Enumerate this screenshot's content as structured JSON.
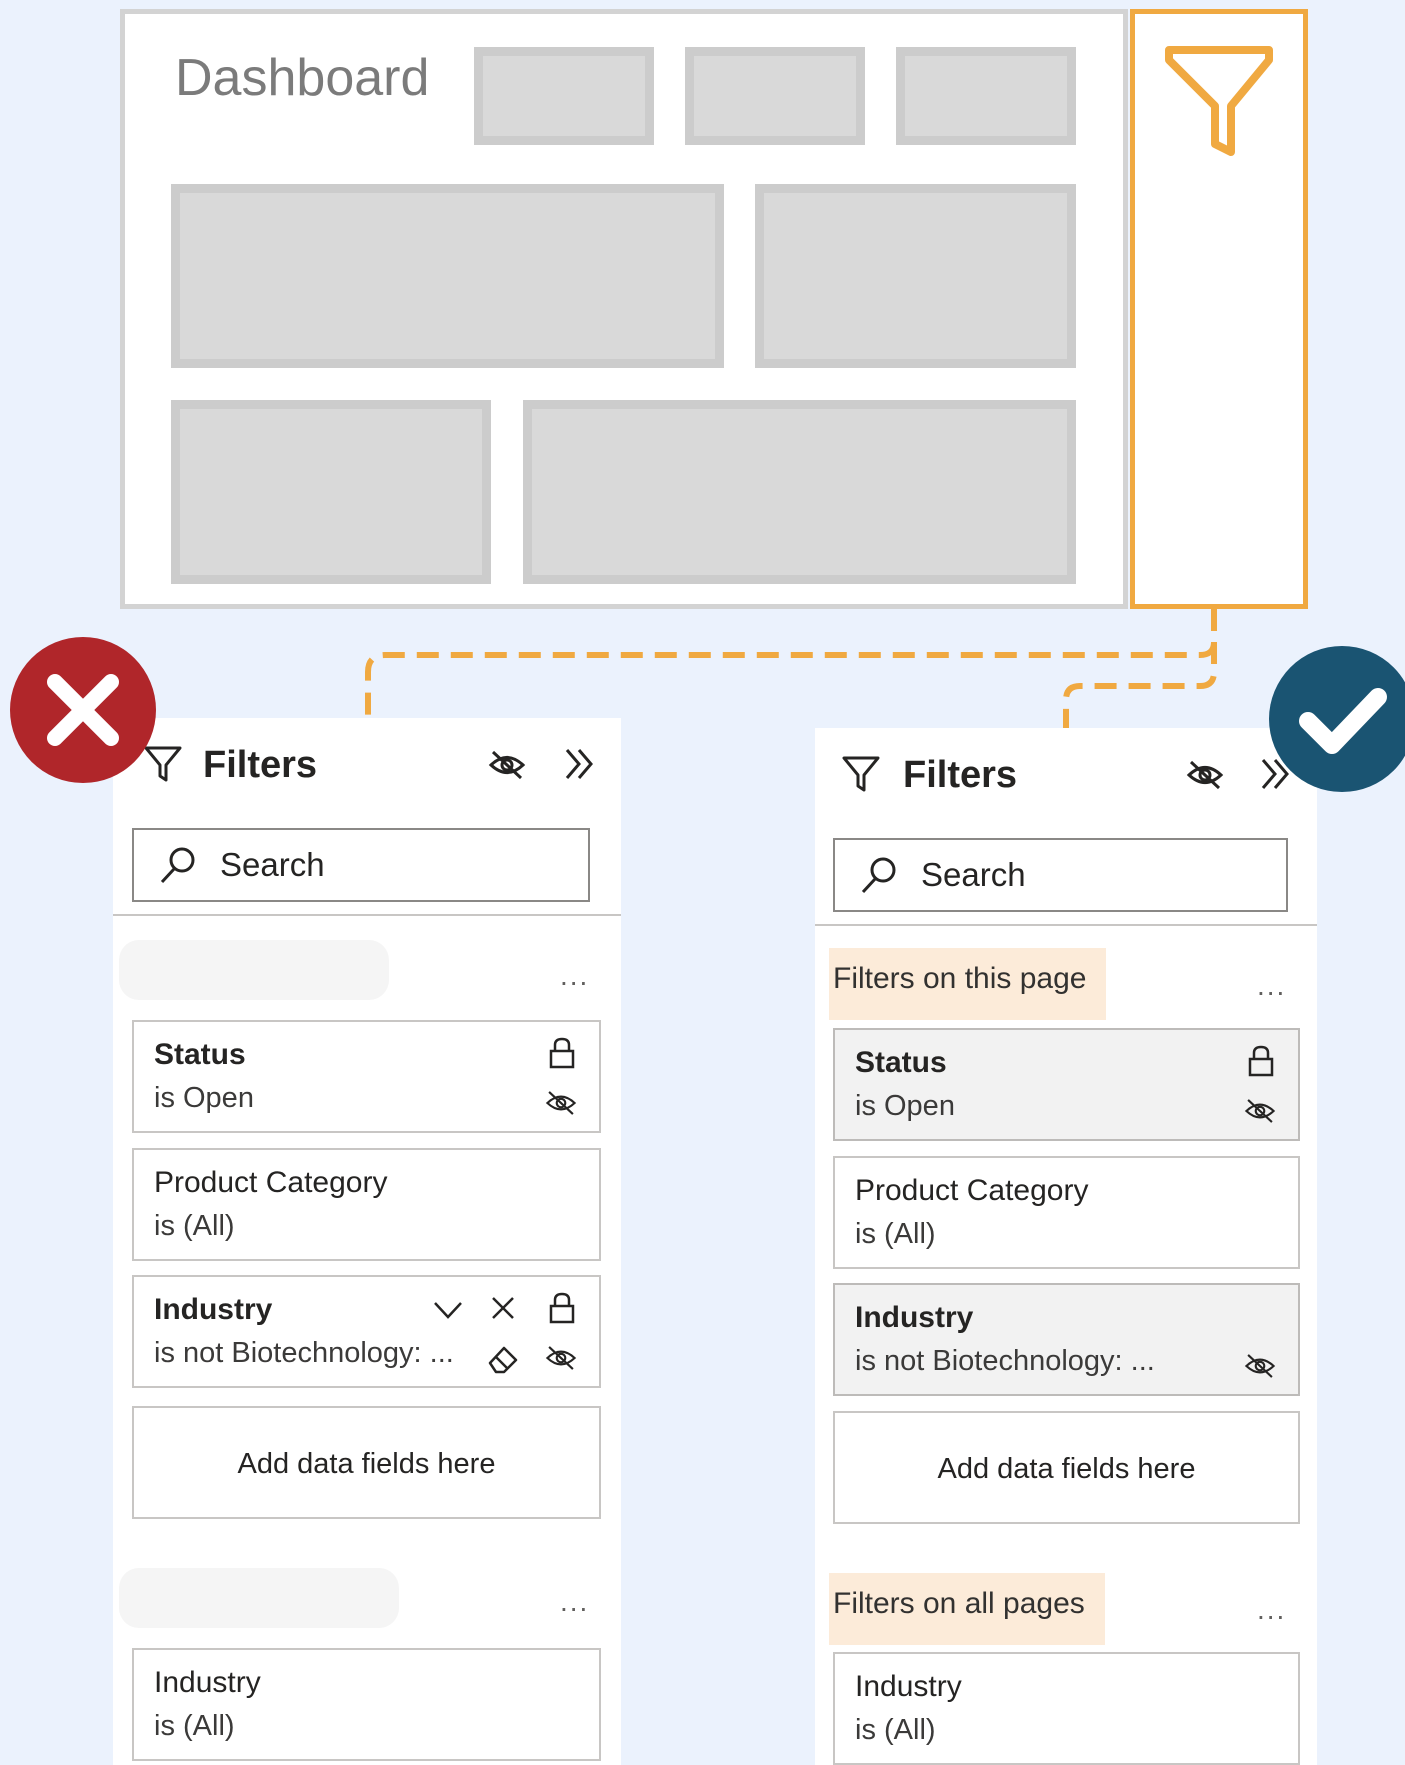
{
  "dashboard": {
    "title": "Dashboard"
  },
  "colors": {
    "background": "#ebf2fd",
    "accent_orange": "#f0a941",
    "wrong_red": "#b0262a",
    "right_blue": "#1a5472",
    "section_highlight": "#fcebd9"
  },
  "icons": {
    "funnel": "filter-funnel-icon",
    "eye_hidden": "eye-hidden-icon",
    "collapse": "chevron-double-right-icon",
    "search": "search-icon",
    "lock": "lock-icon",
    "chevron_down": "chevron-down-icon",
    "close": "close-icon",
    "eraser": "eraser-icon",
    "wrong": "x-circle-icon",
    "right": "check-circle-icon"
  },
  "bad_pane": {
    "title": "Filters",
    "search_placeholder": "Search",
    "section1_more": "...",
    "cards": [
      {
        "title": "Status",
        "value": "is Open"
      },
      {
        "title": "Product Category",
        "value": "is (All)"
      },
      {
        "title": "Industry",
        "value": "is not Biotechnology: ..."
      }
    ],
    "add_fields": "Add data fields here",
    "section2_more": "...",
    "all_pages_card": {
      "title": "Industry",
      "value": "is (All)"
    }
  },
  "good_pane": {
    "title": "Filters",
    "search_placeholder": "Search",
    "section1_label": "Filters on this page",
    "section1_more": "...",
    "cards": [
      {
        "title": "Status",
        "value": "is Open"
      },
      {
        "title": "Product Category",
        "value": "is (All)"
      },
      {
        "title": "Industry",
        "value": "is not Biotechnology: ..."
      }
    ],
    "add_fields": "Add data fields here",
    "section2_label": "Filters on all pages",
    "section2_more": "...",
    "all_pages_card": {
      "title": "Industry",
      "value": "is (All)"
    }
  }
}
